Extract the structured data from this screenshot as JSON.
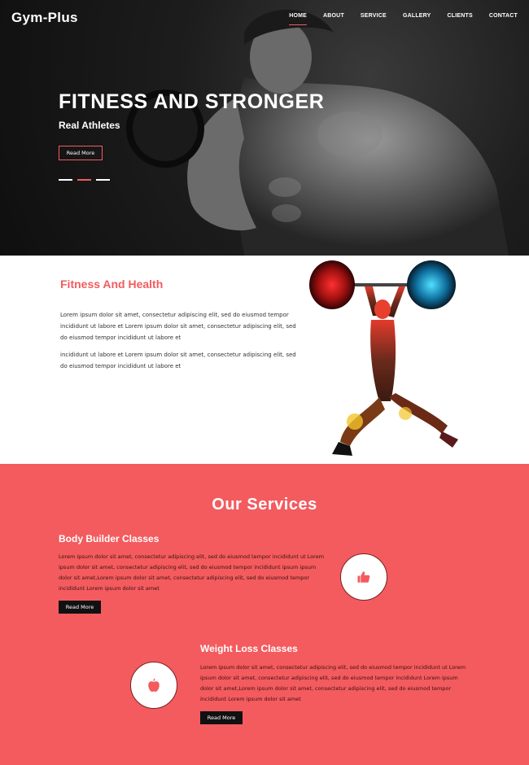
{
  "header": {
    "brand": "Gym-Plus",
    "nav": [
      {
        "label": "HOME",
        "active": true
      },
      {
        "label": "ABOUT"
      },
      {
        "label": "SERVICE"
      },
      {
        "label": "GALLERY"
      },
      {
        "label": "CLIENTS"
      },
      {
        "label": "CONTACT"
      }
    ]
  },
  "hero": {
    "title": "FITNESS AND STRONGER",
    "subtitle": "Real Athletes",
    "button": "Read More",
    "slides_active_index": 1
  },
  "about": {
    "title": "Fitness And Health",
    "para1": "Lorem ipsum dolor sit amet, consectetur adipiscing elit, sed do eiusmod tempor incididunt ut labore et Lorem ipsum dolor sit amet, consectetur adipiscing elit, sed do eiusmod tempor incididunt ut labore et",
    "para2": "incididunt ut labore et Lorem ipsum dolor sit amet, consectetur adipiscing elit, sed do eiusmod tempor incididunt ut labore et"
  },
  "services": {
    "title": "Our Services",
    "items": [
      {
        "title": "Body Builder Classes",
        "text": "Lorem ipsum dolor sit amet, consectetur adipiscing elit, sed do eiusmod tempor incididunt ut Lorem ipsum dolor sit amet, consectetur adipiscing elit, sed do eiusmod tempor incididunt ipsum ipsum dolor sit amet,Lorem ipsum dolor sit amet, consectetur adipiscing elit, sed do eiusmod tempor incididunt Lorem ipsum dolor sit amet",
        "button": "Read More",
        "icon": "thumbs-up-icon"
      },
      {
        "title": "Weight Loss Classes",
        "text": "Lorem ipsum dolor sit amet, consectetur adipiscing elit, sed do eiusmod tempor incididunt ut Lorem ipsum dolor sit amet, consectetur adipiscing elit, sed do eiusmod tempor incididunt Lorem ipsum dolor sit amet,Lorem ipsum dolor sit amet, consectetur adipiscing elit, sed do eiusmod tempor incididunt Lorem ipsum dolor sit amet",
        "button": "Read More",
        "icon": "apple-icon"
      }
    ]
  },
  "colors": {
    "accent": "#f35b5e",
    "dark": "#111111"
  }
}
